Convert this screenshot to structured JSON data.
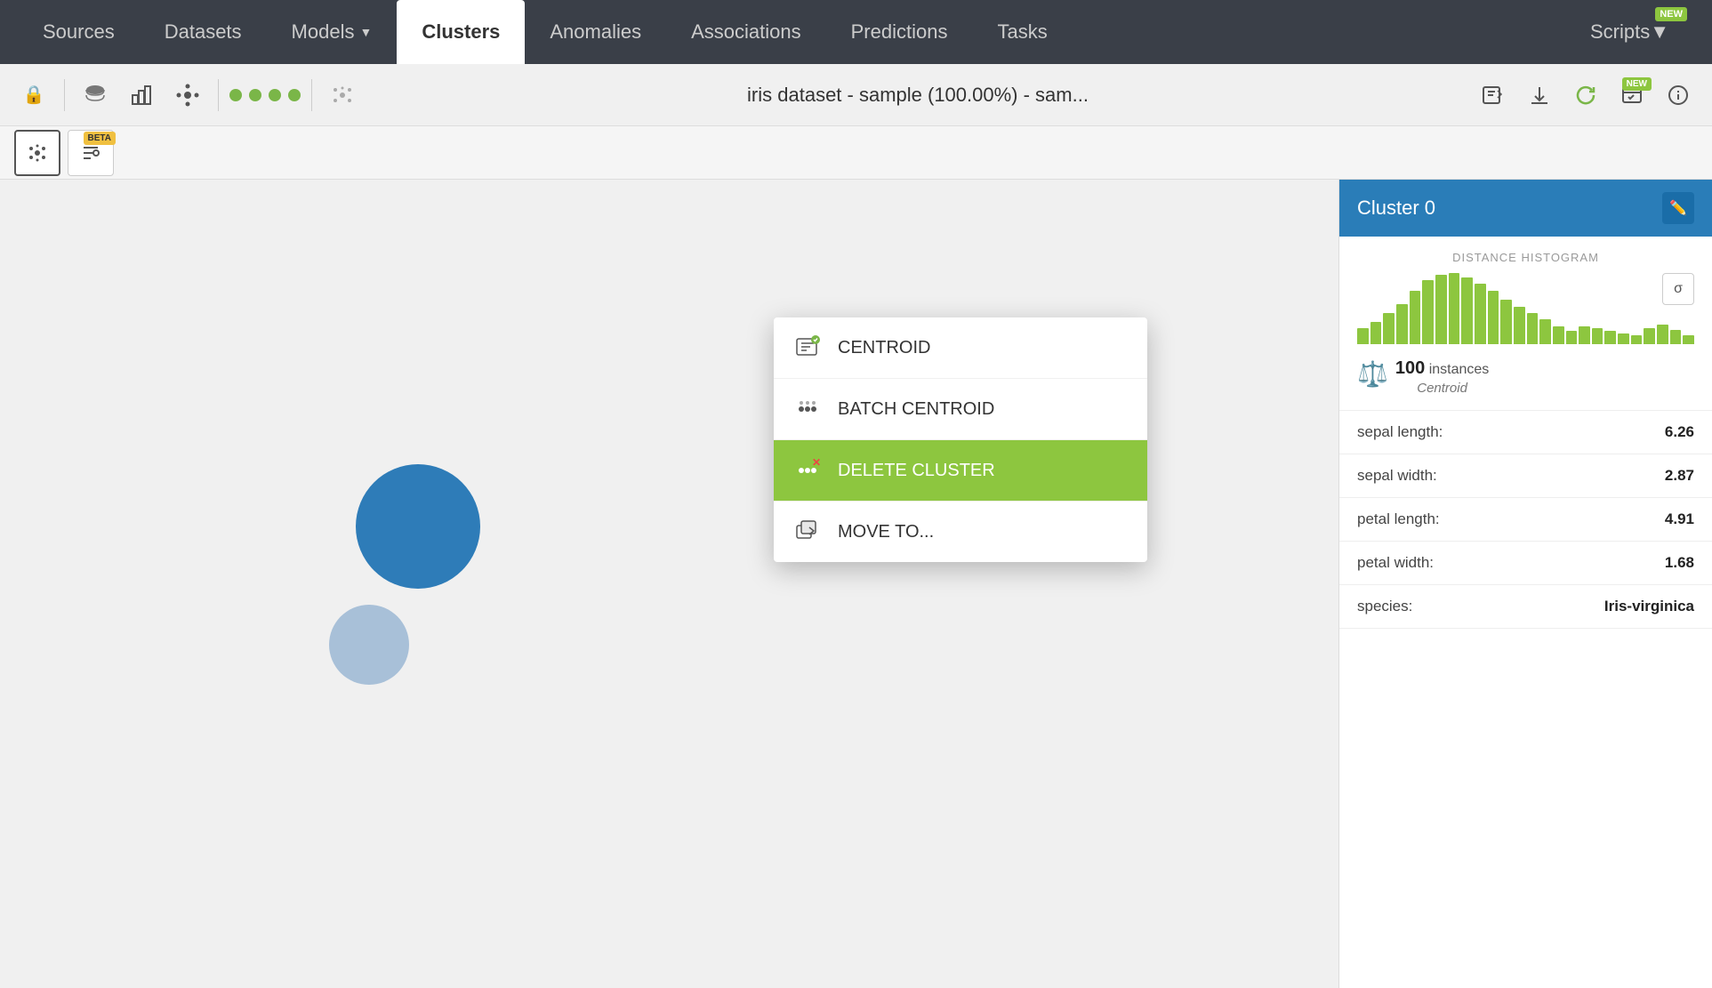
{
  "nav": {
    "items": [
      {
        "label": "Sources",
        "active": false
      },
      {
        "label": "Datasets",
        "active": false
      },
      {
        "label": "Models",
        "active": false,
        "has_chevron": true
      },
      {
        "label": "Clusters",
        "active": true
      },
      {
        "label": "Anomalies",
        "active": false
      },
      {
        "label": "Associations",
        "active": false
      },
      {
        "label": "Predictions",
        "active": false
      },
      {
        "label": "Tasks",
        "active": false
      }
    ],
    "scripts_label": "Scripts",
    "new_badge": "NEW"
  },
  "toolbar": {
    "title": "iris dataset - sample (100.00%) - sam...",
    "dots": 4,
    "new_badge": "NEW"
  },
  "dropdown": {
    "items": [
      {
        "label": "CENTROID",
        "active": false
      },
      {
        "label": "BATCH CENTROID",
        "active": false
      },
      {
        "label": "DELETE CLUSTER",
        "active": true
      },
      {
        "label": "MOVE TO...",
        "active": false
      }
    ]
  },
  "panel": {
    "cluster_name": "Cluster 0",
    "histogram_label": "DISTANCE HISTOGRAM",
    "instances": "100",
    "instances_label": "instances",
    "centroid_label": "Centroid",
    "sigma": "σ",
    "stats": [
      {
        "label": "sepal length:",
        "value": "6.26"
      },
      {
        "label": "sepal width:",
        "value": "2.87"
      },
      {
        "label": "petal length:",
        "value": "4.91"
      },
      {
        "label": "petal width:",
        "value": "1.68"
      },
      {
        "label": "species:",
        "value": "Iris-virginica"
      }
    ]
  },
  "bars": [
    18,
    25,
    35,
    45,
    60,
    72,
    78,
    80,
    75,
    68,
    60,
    50,
    42,
    35,
    28,
    20,
    15,
    20,
    18,
    15,
    12,
    10,
    18,
    22,
    16,
    10
  ]
}
